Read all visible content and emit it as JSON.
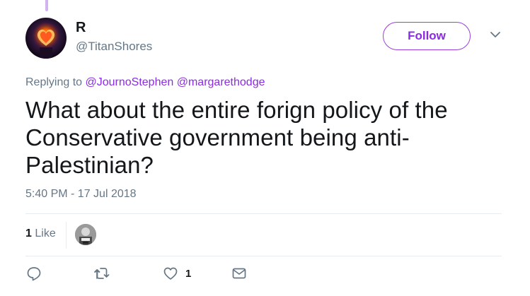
{
  "user": {
    "name": "R",
    "handle": "@TitanShores"
  },
  "follow_label": "Follow",
  "replying": {
    "prefix": "Replying to",
    "mentions": [
      "@JournoStephen",
      "@margarethodge"
    ]
  },
  "tweet_text": "What about the entire forign policy of the Conservative government being anti-Palestinian?",
  "timestamp": "5:40 PM - 17 Jul 2018",
  "likes": {
    "count": "1",
    "label": "Like"
  },
  "actions": {
    "like_count": "1"
  },
  "colors": {
    "accent": "#8a2be2",
    "muted": "#657786",
    "text": "#14171a",
    "divider": "#e6ecf0"
  },
  "icons": [
    "chevron-down-icon",
    "reply-icon",
    "retweet-icon",
    "heart-icon",
    "message-icon"
  ]
}
